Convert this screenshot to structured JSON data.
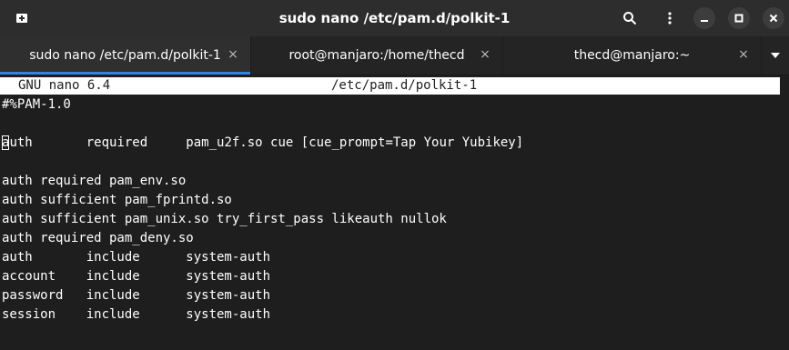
{
  "window": {
    "title": "sudo nano /etc/pam.d/polkit-1"
  },
  "tabs": [
    {
      "label": "sudo nano /etc/pam.d/polkit-1",
      "close": "×",
      "active": true
    },
    {
      "label": "root@manjaro:/home/thecd",
      "close": "×",
      "active": false
    },
    {
      "label": "thecd@manjaro:~",
      "close": "×",
      "active": false
    }
  ],
  "nano": {
    "version": "GNU nano 6.4",
    "filename": "/etc/pam.d/polkit-1"
  },
  "file_lines": [
    "#%PAM-1.0",
    "",
    "auth       required     pam_u2f.so cue [cue_prompt=Tap Your Yubikey]",
    "",
    "auth required pam_env.so",
    "auth sufficient pam_fprintd.so",
    "auth sufficient pam_unix.so try_first_pass likeauth nullok",
    "auth required pam_deny.so",
    "auth       include      system-auth",
    "account    include      system-auth",
    "password   include      system-auth",
    "session    include      system-auth"
  ],
  "cursor": {
    "line": 3,
    "column": 1,
    "char": "a",
    "rest": "uth       required     pam_u2f.so cue [cue_prompt=Tap Your Yubikey]"
  },
  "colors": {
    "titlebar": "#2d2d2d",
    "tabbar": "#242424",
    "active_tab": "#2f2f2f",
    "accent": "#3584e4",
    "terminal_bg": "#1e1e1e",
    "text": "#ffffff"
  }
}
